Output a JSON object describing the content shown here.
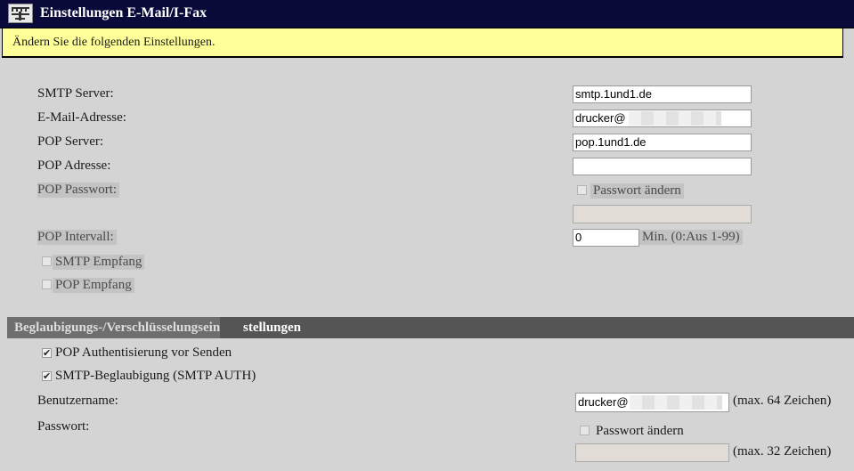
{
  "window": {
    "title": "Einstellungen E-Mail/I-Fax",
    "icon": "fax-icon"
  },
  "notice": {
    "text": "Ändern Sie die folgenden Einstellungen."
  },
  "email_settings": {
    "smtp_server": {
      "label": "SMTP Server:",
      "value": "smtp.1und1.de"
    },
    "email_address": {
      "label": "E-Mail-Adresse:",
      "value": "drucker@"
    },
    "pop_server": {
      "label": "POP Server:",
      "value": "pop.1und1.de"
    },
    "pop_address": {
      "label": "POP Adresse:",
      "value": ""
    },
    "pop_password": {
      "label": "POP Passwort:",
      "change_label": "Passwort ändern",
      "checked": false,
      "value": ""
    },
    "pop_interval": {
      "label": "POP Intervall:",
      "value": "0",
      "unit": "Min. (0:Aus 1-99)"
    },
    "smtp_receive": {
      "label": "SMTP Empfang",
      "checked": false
    },
    "pop_receive": {
      "label": "POP Empfang",
      "checked": false
    }
  },
  "auth_section": {
    "title_part1": "Beglaubigungs-/Verschlüsselungsein",
    "title_part2": "stellungen",
    "pop_before_smtp": {
      "label": "POP Authentisierung vor Senden",
      "checked": true
    },
    "smtp_auth": {
      "label": "SMTP-Beglaubigung (SMTP AUTH)",
      "checked": true
    },
    "username": {
      "label": "Benutzername:",
      "value": "drucker@",
      "hint": "(max. 64 Zeichen)"
    },
    "password": {
      "label": "Passwort:",
      "change_label": "Passwort ändern",
      "checked": false,
      "hint": "(max. 32 Zeichen)"
    }
  },
  "check_glyph": "✔"
}
